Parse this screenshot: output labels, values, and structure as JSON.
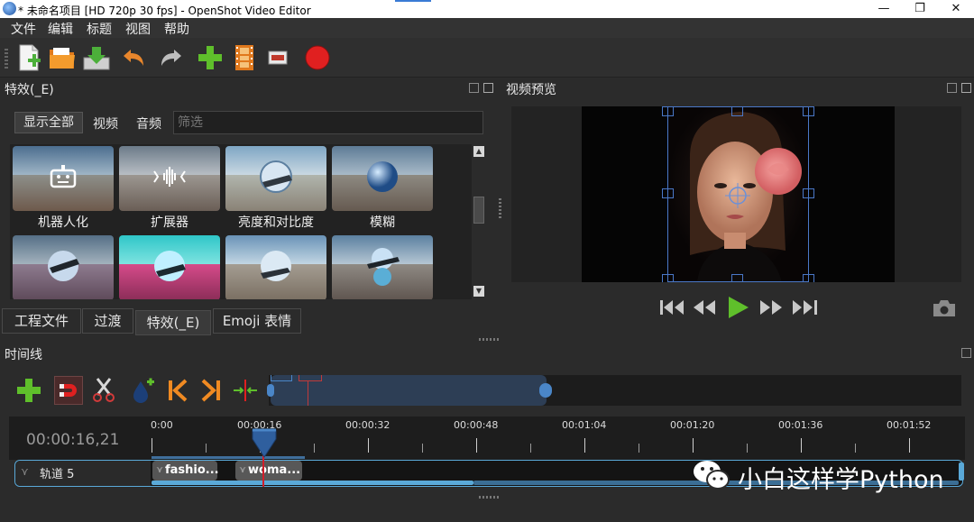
{
  "window": {
    "title": "* 未命名项目 [HD 720p 30 fps] - OpenShot Video Editor",
    "minimize": "—",
    "restore": "❐",
    "close": "✕"
  },
  "menu": [
    "文件",
    "编辑",
    "标题",
    "视图",
    "帮助"
  ],
  "toolbar": {
    "icons": [
      "new-project-icon",
      "open-project-icon",
      "save-project-icon",
      "undo-icon",
      "redo-icon",
      "import-files-icon",
      "profile-icon",
      "export-frame-icon",
      "record-icon"
    ]
  },
  "effects_panel": {
    "title": "特效(_E)",
    "filter_buttons": [
      "显示全部",
      "视频",
      "音频"
    ],
    "filter_placeholder": "筛选",
    "items": [
      {
        "label": "机器人化",
        "icon": "robot-icon"
      },
      {
        "label": "扩展器",
        "icon": "expander-icon"
      },
      {
        "label": "亮度和对比度",
        "icon": "brightness-icon"
      },
      {
        "label": "模糊",
        "icon": "blur-icon"
      },
      {
        "label": "",
        "icon": "effect-icon"
      },
      {
        "label": "",
        "icon": "effect-icon"
      },
      {
        "label": "",
        "icon": "effect-icon"
      },
      {
        "label": "",
        "icon": "effect-icon"
      }
    ]
  },
  "bottom_tabs": [
    "工程文件",
    "过渡",
    "特效(_E)",
    "Emoji 表情"
  ],
  "preview_panel": {
    "title": "视频预览"
  },
  "playback": {
    "buttons": [
      "jump-start-icon",
      "rewind-icon",
      "play-icon",
      "fast-forward-icon",
      "jump-end-icon"
    ]
  },
  "timeline": {
    "title": "时间线",
    "current_time": "00:00:16,21",
    "ruler_labels": [
      "0:00",
      "00:00:16",
      "00:00:32",
      "00:00:48",
      "00:01:04",
      "00:01:20",
      "00:01:36",
      "00:01:52"
    ],
    "track_name": "轨道 5",
    "clips": [
      "fashio...",
      "woma..."
    ]
  },
  "watermark": "小白这样学Python",
  "colors": {
    "accent": "#3a7bd5",
    "playhead": "#d21e2b",
    "play_green": "#5fbf2b",
    "record_red": "#e02020"
  }
}
